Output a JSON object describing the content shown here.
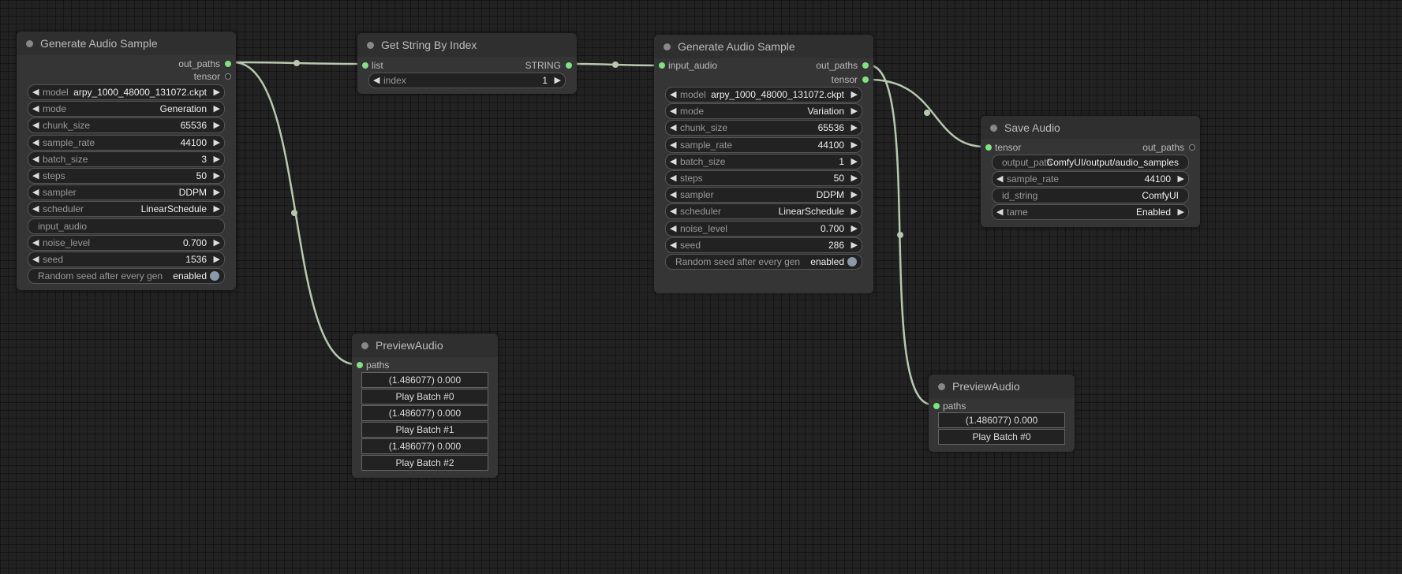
{
  "node1": {
    "title": "Generate Audio Sample",
    "outputs": [
      "out_paths",
      "tensor"
    ],
    "widgets": [
      {
        "name": "model",
        "value": "arpy_1000_48000_131072.ckpt"
      },
      {
        "name": "mode",
        "value": "Generation"
      },
      {
        "name": "chunk_size",
        "value": "65536"
      },
      {
        "name": "sample_rate",
        "value": "44100"
      },
      {
        "name": "batch_size",
        "value": "3"
      },
      {
        "name": "steps",
        "value": "50"
      },
      {
        "name": "sampler",
        "value": "DDPM"
      },
      {
        "name": "scheduler",
        "value": "LinearSchedule"
      },
      {
        "name": "input_audio",
        "value": ""
      },
      {
        "name": "noise_level",
        "value": "0.700"
      },
      {
        "name": "seed",
        "value": "1536"
      },
      {
        "name": "Random seed after every gen",
        "value": "enabled"
      }
    ]
  },
  "node2": {
    "title": "Get String By Index",
    "input": "list",
    "output": "STRING",
    "widgets": [
      {
        "name": "index",
        "value": "1"
      }
    ]
  },
  "node3": {
    "title": "Generate Audio Sample",
    "input": "input_audio",
    "outputs": [
      "out_paths",
      "tensor"
    ],
    "widgets": [
      {
        "name": "model",
        "value": "arpy_1000_48000_131072.ckpt"
      },
      {
        "name": "mode",
        "value": "Variation"
      },
      {
        "name": "chunk_size",
        "value": "65536"
      },
      {
        "name": "sample_rate",
        "value": "44100"
      },
      {
        "name": "batch_size",
        "value": "1"
      },
      {
        "name": "steps",
        "value": "50"
      },
      {
        "name": "sampler",
        "value": "DDPM"
      },
      {
        "name": "scheduler",
        "value": "LinearSchedule"
      },
      {
        "name": "noise_level",
        "value": "0.700"
      },
      {
        "name": "seed",
        "value": "286"
      },
      {
        "name": "Random seed after every gen",
        "value": "enabled"
      }
    ]
  },
  "node4": {
    "title": "Save Audio",
    "input": "tensor",
    "output": "out_paths",
    "widgets": [
      {
        "name": "output_path",
        "value": "ComfyUI/output/audio_samples"
      },
      {
        "name": "sample_rate",
        "value": "44100"
      },
      {
        "name": "id_string",
        "value": "ComfyUI"
      },
      {
        "name": "tame",
        "value": "Enabled"
      }
    ]
  },
  "node5": {
    "title": "PreviewAudio",
    "input": "paths",
    "items": [
      "(1.486077)  0.000",
      "Play Batch #0",
      "(1.486077)  0.000",
      "Play Batch #1",
      "(1.486077)  0.000",
      "Play Batch #2"
    ]
  },
  "node6": {
    "title": "PreviewAudio",
    "input": "paths",
    "items": [
      "(1.486077)  0.000",
      "Play Batch #0"
    ]
  },
  "colors": {
    "canvas": "#222222",
    "node_body": "#353535",
    "link": "#b8c8b0",
    "slot_connected": "#7fe37f"
  }
}
